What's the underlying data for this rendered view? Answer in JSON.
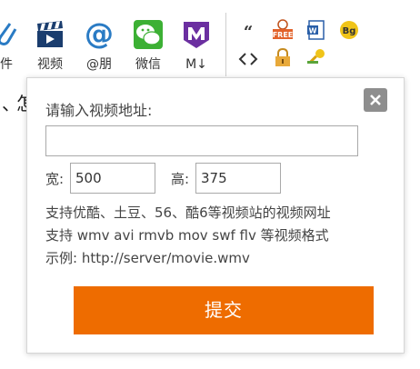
{
  "toolbar": {
    "items": [
      {
        "label": "件",
        "icon": "attachment-icon"
      },
      {
        "label": "视频",
        "icon": "video-clapper-icon"
      },
      {
        "label": "@朋",
        "icon": "at-mention-icon"
      },
      {
        "label": "微信",
        "icon": "wechat-icon"
      },
      {
        "label": "M↓",
        "icon": "markdown-icon"
      }
    ],
    "small_icons": [
      "quote-icon",
      "free-tag-icon",
      "word-doc-icon",
      "bg-badge-icon",
      "code-icon",
      "lock-icon",
      "key-user-icon"
    ],
    "free_badge_text": "FREE",
    "bg_badge_text": "Bg",
    "word_badge_text": "W"
  },
  "editor": {
    "glyph_left": "、",
    "glyph_right": "怎"
  },
  "dialog": {
    "prompt": "请输入视频地址:",
    "url_value": "",
    "width_label": "宽:",
    "width_value": "500",
    "height_label": "高:",
    "height_value": "375",
    "help_lines": [
      "支持优酷、土豆、56、酷6等视频站的视频网址",
      "支持 wmv avi rmvb mov swf flv 等视频格式",
      "示例: http://server/movie.wmv"
    ],
    "submit_label": "提交",
    "close_icon": "close-icon"
  },
  "colors": {
    "accent": "#ee6c00",
    "close_bg": "#8e8e8e",
    "video_icon": "#1a3d6e",
    "at_icon": "#2a7bc4",
    "wechat_icon": "#3cb034",
    "markdown_icon": "#6b2fa0"
  }
}
